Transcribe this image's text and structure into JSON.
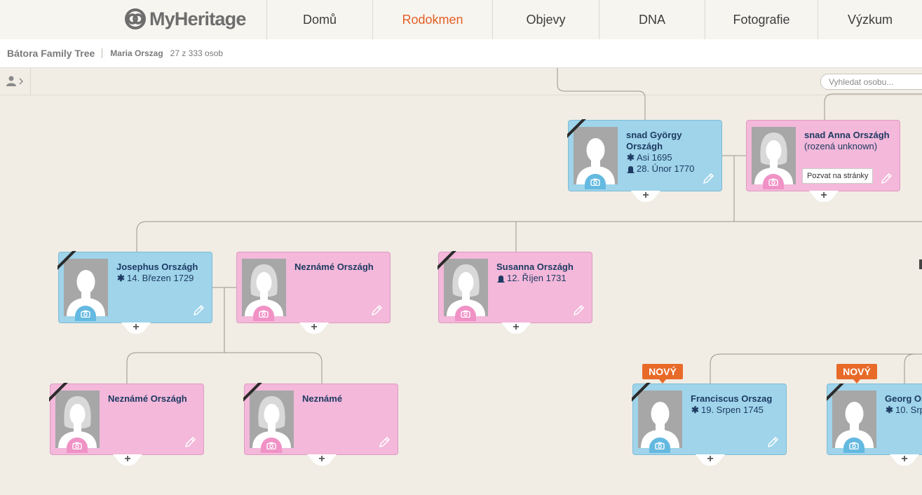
{
  "logo": {
    "text": "MyHeritage"
  },
  "nav": {
    "items": [
      {
        "label": "Domů"
      },
      {
        "label": "Rodokmen",
        "active": true
      },
      {
        "label": "Objevy"
      },
      {
        "label": "DNA"
      },
      {
        "label": "Fotografie"
      },
      {
        "label": "Výzkum"
      }
    ]
  },
  "subheader": {
    "tree_name": "Bátora Family Tree",
    "person": "Maria Orszag",
    "count": "27 z 333 osob"
  },
  "toolbar": {
    "search_placeholder": "Vyhledat osobu..."
  },
  "colors": {
    "male_card": "#9fd4ea",
    "female_card": "#f3b8da",
    "accent": "#e25f25",
    "badge": "#e86a28",
    "background": "#f1ede4"
  },
  "people": {
    "gyorgy": {
      "name_line1": "snad György",
      "name_line2": "Országh",
      "birth": "Asi 1695",
      "death": "28. Únor 1770"
    },
    "anna": {
      "name": "snad Anna Országh",
      "sub": "(rozená unknown)",
      "invite": "Pozvat na stránky"
    },
    "josephus": {
      "name": "Josephus Országh",
      "birth": "14. Březen 1729"
    },
    "nezname_wife": {
      "name": "Neznámé Országh"
    },
    "susanna": {
      "name": "Susanna Országh",
      "death": "12. Říjen 1731"
    },
    "child1": {
      "name": "Neznámé Országh"
    },
    "child2": {
      "name": "Neznámé"
    },
    "franciscus": {
      "name": "Franciscus Orszag",
      "birth": "19. Srpen 1745",
      "badge": "NOVÝ"
    },
    "georg": {
      "name": "Georg Or",
      "birth": "10. Srp",
      "badge": "NOVÝ"
    }
  },
  "icons": {
    "birth": "asterisk-icon",
    "death": "tombstone-icon",
    "photo": "camera-icon",
    "edit": "pencil-icon",
    "add": "plus-icon",
    "deceased": "mourning-ribbon-icon"
  }
}
